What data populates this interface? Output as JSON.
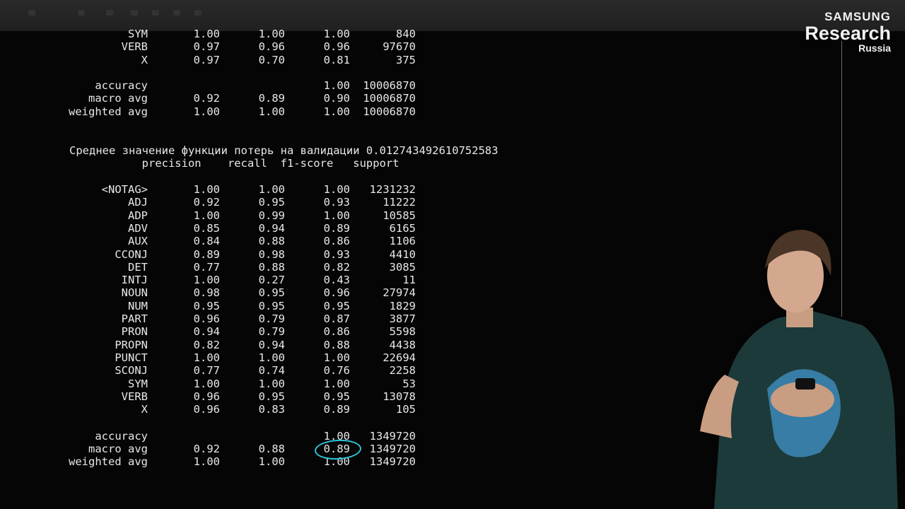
{
  "logo": {
    "line1": "SAMSUNG",
    "line2": "Research",
    "line3": "Russia"
  },
  "report1": {
    "rows": [
      {
        "label": "SYM",
        "precision": "1.00",
        "recall": "1.00",
        "f1": "1.00",
        "support": "840"
      },
      {
        "label": "VERB",
        "precision": "0.97",
        "recall": "0.96",
        "f1": "0.96",
        "support": "97670"
      },
      {
        "label": "X",
        "precision": "0.97",
        "recall": "0.70",
        "f1": "0.81",
        "support": "375"
      }
    ],
    "summary": [
      {
        "label": "accuracy",
        "precision": "",
        "recall": "",
        "f1": "1.00",
        "support": "10006870"
      },
      {
        "label": "macro avg",
        "precision": "0.92",
        "recall": "0.89",
        "f1": "0.90",
        "support": "10006870"
      },
      {
        "label": "weighted avg",
        "precision": "1.00",
        "recall": "1.00",
        "f1": "1.00",
        "support": "10006870"
      }
    ]
  },
  "loss_line": "Среднее значение функции потерь на валидации 0.012743492610752583",
  "header": "           precision    recall  f1-score   support",
  "report2": {
    "rows": [
      {
        "label": "<NOTAG>",
        "precision": "1.00",
        "recall": "1.00",
        "f1": "1.00",
        "support": "1231232"
      },
      {
        "label": "ADJ",
        "precision": "0.92",
        "recall": "0.95",
        "f1": "0.93",
        "support": "11222"
      },
      {
        "label": "ADP",
        "precision": "1.00",
        "recall": "0.99",
        "f1": "1.00",
        "support": "10585"
      },
      {
        "label": "ADV",
        "precision": "0.85",
        "recall": "0.94",
        "f1": "0.89",
        "support": "6165"
      },
      {
        "label": "AUX",
        "precision": "0.84",
        "recall": "0.88",
        "f1": "0.86",
        "support": "1106"
      },
      {
        "label": "CCONJ",
        "precision": "0.89",
        "recall": "0.98",
        "f1": "0.93",
        "support": "4410"
      },
      {
        "label": "DET",
        "precision": "0.77",
        "recall": "0.88",
        "f1": "0.82",
        "support": "3085"
      },
      {
        "label": "INTJ",
        "precision": "1.00",
        "recall": "0.27",
        "f1": "0.43",
        "support": "11"
      },
      {
        "label": "NOUN",
        "precision": "0.98",
        "recall": "0.95",
        "f1": "0.96",
        "support": "27974"
      },
      {
        "label": "NUM",
        "precision": "0.95",
        "recall": "0.95",
        "f1": "0.95",
        "support": "1829"
      },
      {
        "label": "PART",
        "precision": "0.96",
        "recall": "0.79",
        "f1": "0.87",
        "support": "3877"
      },
      {
        "label": "PRON",
        "precision": "0.94",
        "recall": "0.79",
        "f1": "0.86",
        "support": "5598"
      },
      {
        "label": "PROPN",
        "precision": "0.82",
        "recall": "0.94",
        "f1": "0.88",
        "support": "4438"
      },
      {
        "label": "PUNCT",
        "precision": "1.00",
        "recall": "1.00",
        "f1": "1.00",
        "support": "22694"
      },
      {
        "label": "SCONJ",
        "precision": "0.77",
        "recall": "0.74",
        "f1": "0.76",
        "support": "2258"
      },
      {
        "label": "SYM",
        "precision": "1.00",
        "recall": "1.00",
        "f1": "1.00",
        "support": "53"
      },
      {
        "label": "VERB",
        "precision": "0.96",
        "recall": "0.95",
        "f1": "0.95",
        "support": "13078"
      },
      {
        "label": "X",
        "precision": "0.96",
        "recall": "0.83",
        "f1": "0.89",
        "support": "105"
      }
    ],
    "summary": [
      {
        "label": "accuracy",
        "precision": "",
        "recall": "",
        "f1": "1.00",
        "support": "1349720"
      },
      {
        "label": "macro avg",
        "precision": "0.92",
        "recall": "0.88",
        "f1": "0.89",
        "support": "1349720"
      },
      {
        "label": "weighted avg",
        "precision": "1.00",
        "recall": "1.00",
        "f1": "1.00",
        "support": "1349720"
      }
    ]
  },
  "annotation": {
    "circled_value": "0.89",
    "color": "#2fc6dc"
  }
}
